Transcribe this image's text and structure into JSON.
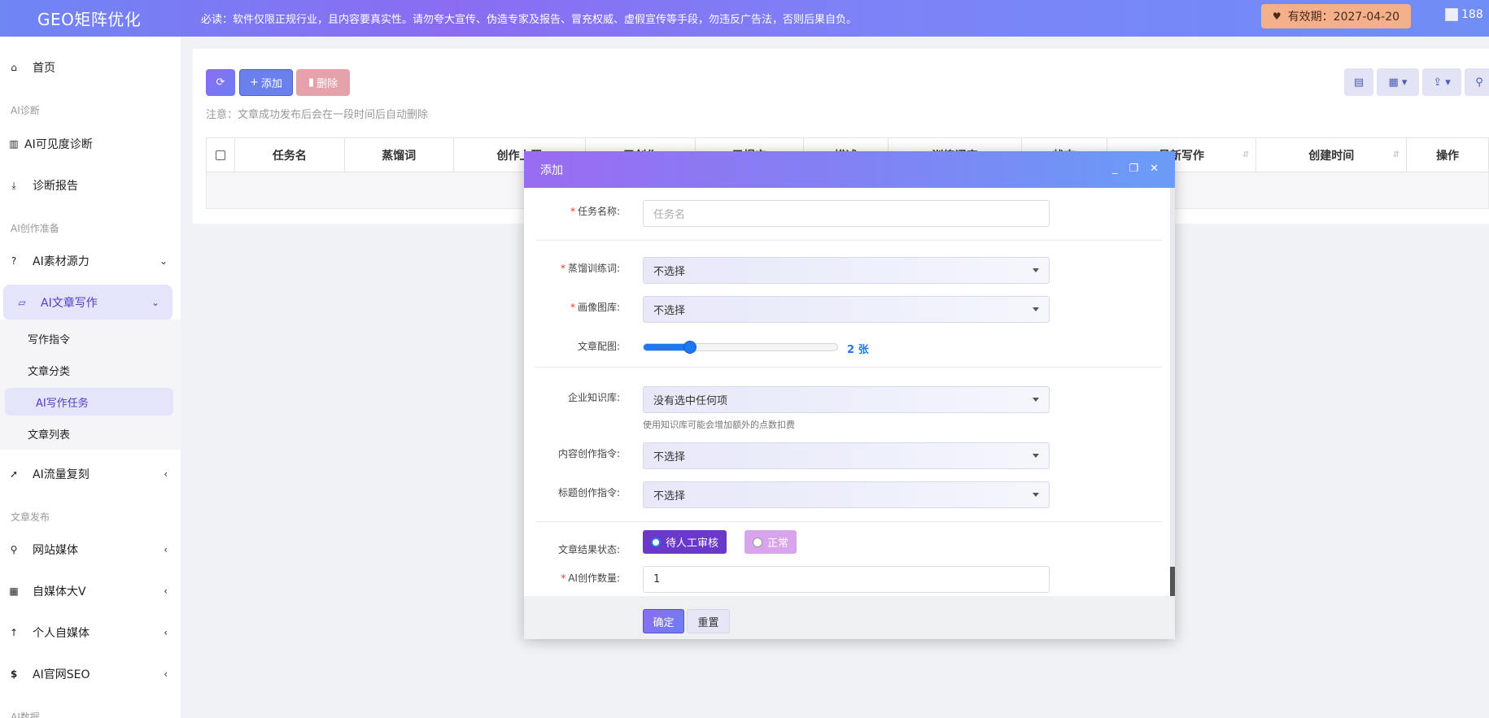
{
  "header": {
    "logo": "GEO矩阵优化",
    "notice": "必读：软件仅限正规行业，且内容要真实性。请勿夸大宣传、伪造专家及报告、冒充权威、虚假宣传等手段，勿违反广告法，否则后果自负。",
    "expiry_label": "有效期：2027-04-20",
    "user_text": "188"
  },
  "sidebar": {
    "home": "首页",
    "section_diag": "AI诊断",
    "visibility": "AI可见度诊断",
    "report": "诊断报告",
    "section_create": "AI创作准备",
    "material": "AI素材源力",
    "writing": "AI文章写作",
    "sub": [
      "写作指令",
      "文章分类",
      "AI写作任务",
      "文章列表"
    ],
    "traffic": "AI流量复刻",
    "section_publish": "文章发布",
    "site_media": "网站媒体",
    "self_media_v": "自媒体大V",
    "personal_media": "个人自媒体",
    "official_seo": "AI官网SEO",
    "section_data": "AI数据"
  },
  "toolbar": {
    "add_label": "添加",
    "delete_label": "删除",
    "hint": "注意：文章成功发布后会在一段时间后自动删除"
  },
  "table": {
    "columns": [
      "任务名",
      "蒸馏词",
      "创作上限",
      "已创作",
      "已提交",
      "描述",
      "训练词库",
      "状态",
      "最新写作",
      "创建时间",
      "操作"
    ]
  },
  "modal": {
    "title": "添加",
    "fields": {
      "task_name_label": "任务名称:",
      "task_name_placeholder": "任务名",
      "distill_label": "蒸馏训练词:",
      "distill_value": "不选择",
      "gallery_label": "画像图库:",
      "gallery_value": "不选择",
      "images_label": "文章配图:",
      "images_value": "2 张",
      "images_count": 2,
      "images_max": 10,
      "kb_label": "企业知识库:",
      "kb_value": "没有选中任何项",
      "kb_help": "使用知识库可能会增加额外的点数扣费",
      "content_cmd_label": "内容创作指令:",
      "content_cmd_value": "不选择",
      "title_cmd_label": "标题创作指令:",
      "title_cmd_value": "不选择",
      "status_label": "文章结果状态:",
      "status_options": [
        "待人工审核",
        "正常"
      ],
      "count_label": "AI创作数量:",
      "count_value": "1"
    },
    "confirm_label": "确定",
    "reset_label": "重置"
  }
}
